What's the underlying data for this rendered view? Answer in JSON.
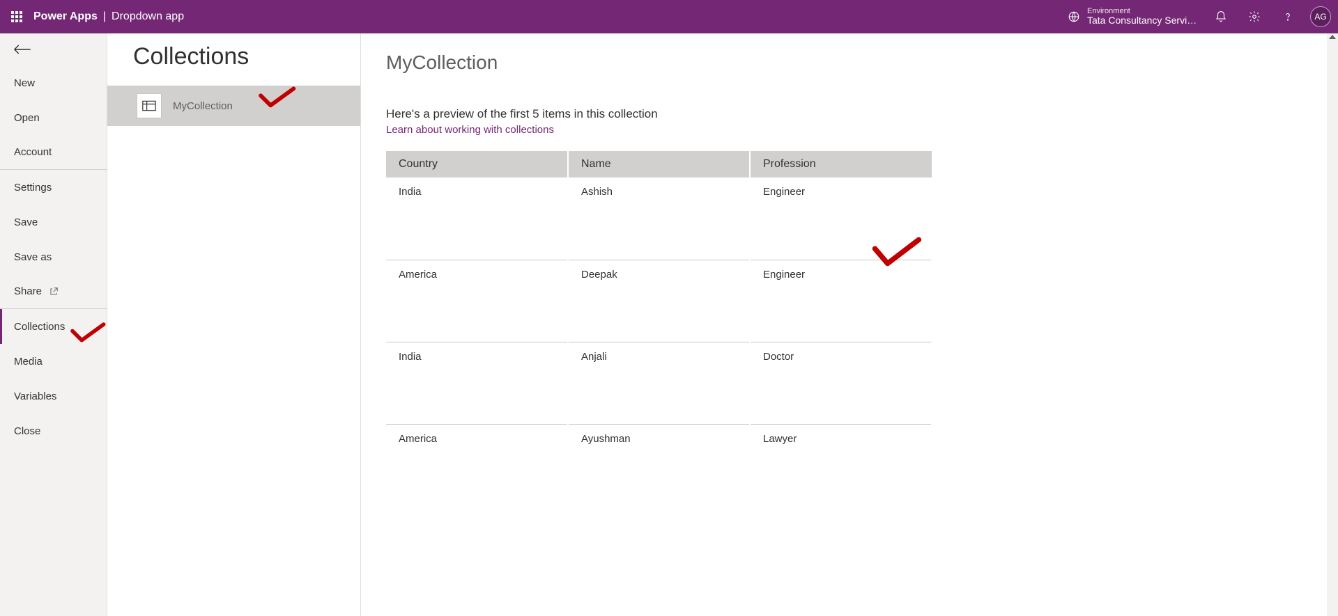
{
  "topbar": {
    "product": "Power Apps",
    "separator": "|",
    "app_name": "Dropdown app",
    "env_label": "Environment",
    "env_name": "Tata Consultancy Servic...",
    "avatar_initials": "AG"
  },
  "sidebar": {
    "items": {
      "new": "New",
      "open": "Open",
      "account": "Account",
      "settings": "Settings",
      "save": "Save",
      "save_as": "Save as",
      "share": "Share",
      "collections": "Collections",
      "media": "Media",
      "variables": "Variables",
      "close": "Close"
    }
  },
  "collections_panel": {
    "title": "Collections",
    "items": [
      {
        "label": "MyCollection"
      }
    ]
  },
  "detail": {
    "title": "MyCollection",
    "preview_text": "Here's a preview of the first 5 items in this collection",
    "learn_link": "Learn about working with collections",
    "columns": [
      "Country",
      "Name",
      "Profession"
    ],
    "rows": [
      {
        "c0": "India",
        "c1": "Ashish",
        "c2": "Engineer"
      },
      {
        "c0": "America",
        "c1": "Deepak",
        "c2": "Engineer"
      },
      {
        "c0": "India",
        "c1": "Anjali",
        "c2": "Doctor"
      },
      {
        "c0": "America",
        "c1": "Ayushman",
        "c2": "Lawyer"
      }
    ]
  }
}
